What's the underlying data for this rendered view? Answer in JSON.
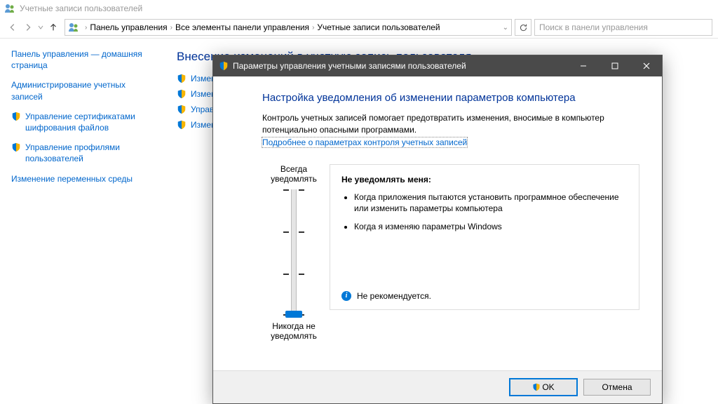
{
  "window": {
    "title": "Учетные записи пользователей"
  },
  "breadcrumb": {
    "root": "Панель управления",
    "mid": "Все элементы панели управления",
    "leaf": "Учетные записи пользователей"
  },
  "search": {
    "placeholder": "Поиск в панели управления"
  },
  "sidebar": {
    "items": [
      {
        "label": "Панель управления — домашняя страница",
        "shield": false
      },
      {
        "label": "Администрирование учетных записей",
        "shield": false
      },
      {
        "label": "Управление сертификатами шифрования файлов",
        "shield": true
      },
      {
        "label": "Управление профилями пользователей",
        "shield": true
      },
      {
        "label": "Изменение переменных среды",
        "shield": false
      }
    ]
  },
  "main": {
    "heading": "Внесение изменений в учетную запись пользователя",
    "links": [
      {
        "label": "Изменение имени учетной записи на компьютере",
        "shield": true
      },
      {
        "label": "Изменение типа учетной записи",
        "shield": true
      },
      {
        "label": "Управление другой учетной записью",
        "shield": true
      },
      {
        "label": "Изменить параметры контроля учетных записей",
        "shield": true
      }
    ]
  },
  "dialog": {
    "title": "Параметры управления учетными записями пользователей",
    "heading": "Настройка уведомления об изменении параметров компьютера",
    "desc": "Контроль учетных записей помогает предотвратить изменения, вносимые в компьютер потенциально опасными программами.",
    "link": "Подробнее о параметрах контроля учетных записей",
    "slider": {
      "top": "Всегда уведомлять",
      "bottom": "Никогда не уведомлять",
      "levels": 4,
      "current_index": 3
    },
    "detail": {
      "title": "Не уведомлять меня:",
      "bullets": [
        "Когда приложения пытаются установить программное обеспечение или изменить параметры компьютера",
        "Когда я изменяю параметры Windows"
      ],
      "recommendation": "Не рекомендуется."
    },
    "buttons": {
      "ok": "OK",
      "cancel": "Отмена"
    }
  }
}
